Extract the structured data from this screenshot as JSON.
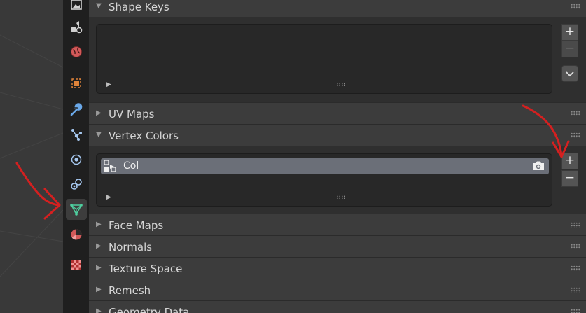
{
  "sections": {
    "shape_keys": {
      "title": "Shape Keys",
      "expanded": true
    },
    "uv_maps": {
      "title": "UV Maps",
      "expanded": false
    },
    "vertex_colors": {
      "title": "Vertex Colors",
      "expanded": true,
      "items": [
        {
          "name": "Col",
          "active": true
        }
      ]
    },
    "face_maps": {
      "title": "Face Maps",
      "expanded": false
    },
    "normals": {
      "title": "Normals",
      "expanded": false
    },
    "texture_space": {
      "title": "Texture Space",
      "expanded": false
    },
    "remesh": {
      "title": "Remesh",
      "expanded": false
    },
    "geometry_data": {
      "title": "Geometry Data",
      "expanded": false
    }
  },
  "tabs": [
    {
      "name": "view-layer",
      "icon": "image-icon"
    },
    {
      "name": "scene",
      "icon": "scene-icon"
    },
    {
      "name": "world",
      "icon": "world-icon"
    },
    {
      "name": "object",
      "icon": "object-icon"
    },
    {
      "name": "modifiers",
      "icon": "wrench-icon"
    },
    {
      "name": "particles",
      "icon": "particles-icon"
    },
    {
      "name": "physics",
      "icon": "physics-icon"
    },
    {
      "name": "constraints",
      "icon": "constraints-icon"
    },
    {
      "name": "object-data",
      "icon": "mesh-data-icon",
      "active": true
    },
    {
      "name": "material",
      "icon": "material-icon"
    },
    {
      "name": "texture",
      "icon": "texture-icon"
    }
  ],
  "buttons": {
    "add": "+",
    "remove": "−"
  },
  "colors": {
    "accent_green": "#4fd0a0",
    "active_item": "#6b6f78",
    "annotation_red": "#d42020",
    "world_red": "#d25a5a",
    "object_orange": "#e0843a",
    "tool_blue": "#6aa8e8"
  }
}
